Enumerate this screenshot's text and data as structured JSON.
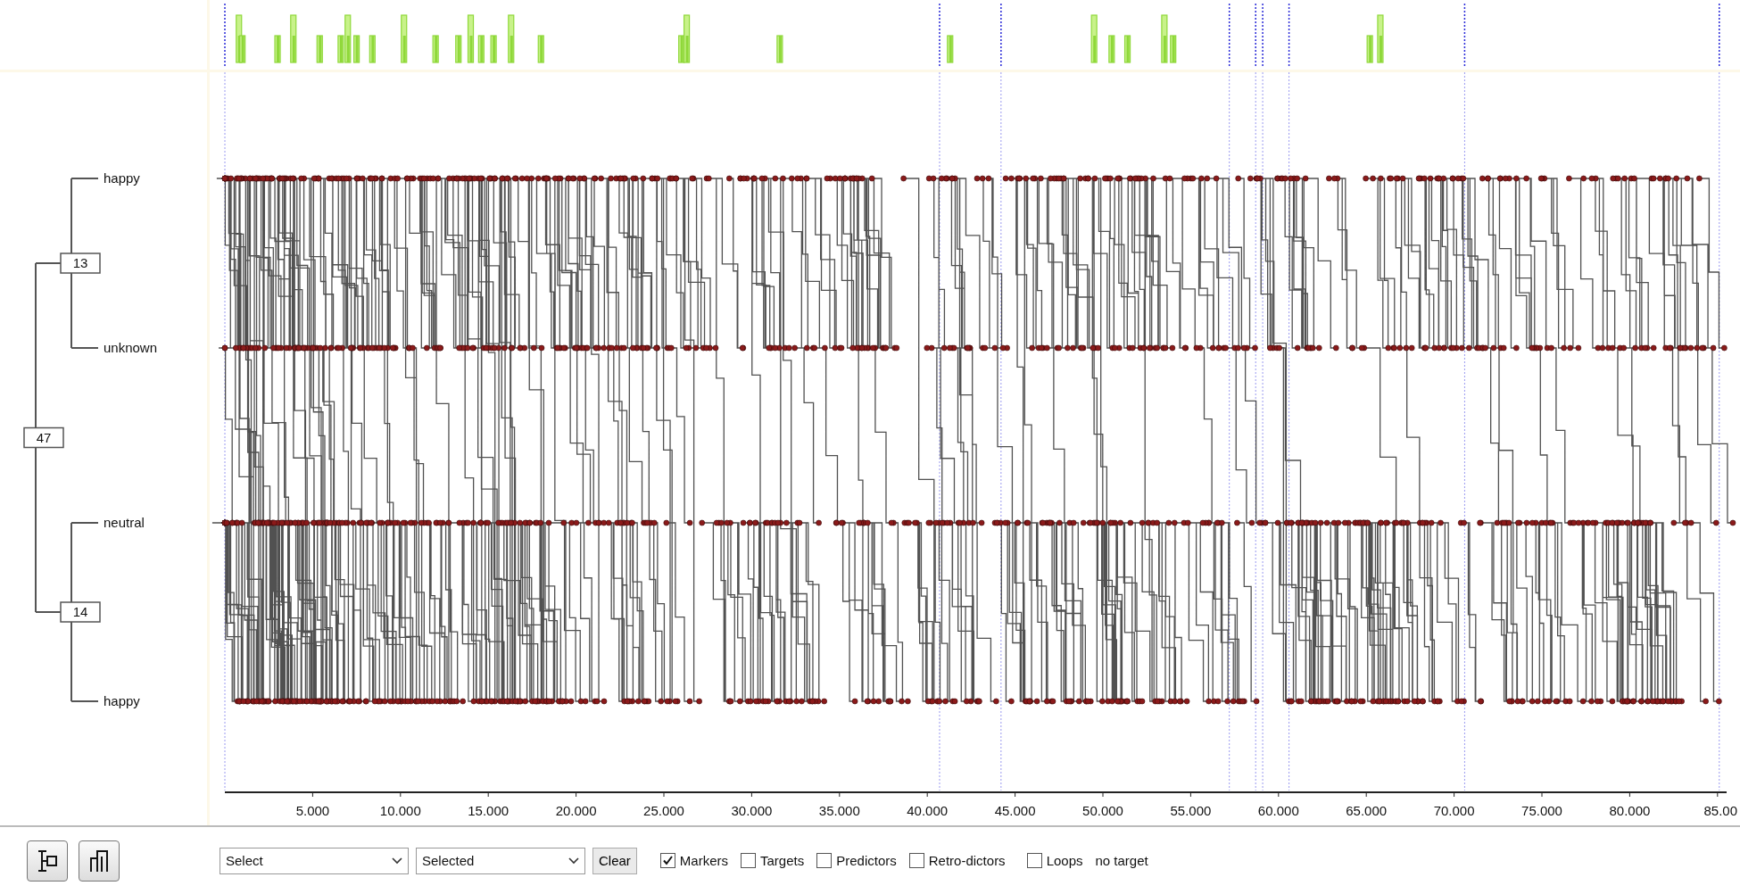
{
  "dendrogram": {
    "label": "47",
    "children": [
      {
        "label": "13",
        "children": [
          {
            "label": "happy"
          },
          {
            "label": "unknown"
          }
        ]
      },
      {
        "label": "14",
        "children": [
          {
            "label": "neutral"
          },
          {
            "label": "happy"
          }
        ]
      }
    ]
  },
  "x_axis_ticks": [
    "5.000",
    "10.000",
    "15.000",
    "20.000",
    "25.000",
    "30.000",
    "35.000",
    "40.000",
    "45.000",
    "50.000",
    "55.000",
    "60.000",
    "65.000",
    "70.000",
    "75.000",
    "80.000",
    "85.00"
  ],
  "toolbar": {
    "select_1": "Select",
    "select_2": "Selected",
    "clear_button": "Clear",
    "checkboxes": [
      {
        "label": "Markers",
        "checked": true
      },
      {
        "label": "Targets",
        "checked": false
      },
      {
        "label": "Predictors",
        "checked": false
      },
      {
        "label": "Retro-dictors",
        "checked": false
      },
      {
        "label": "Loops",
        "checked": false
      }
    ],
    "status": "no target"
  }
}
